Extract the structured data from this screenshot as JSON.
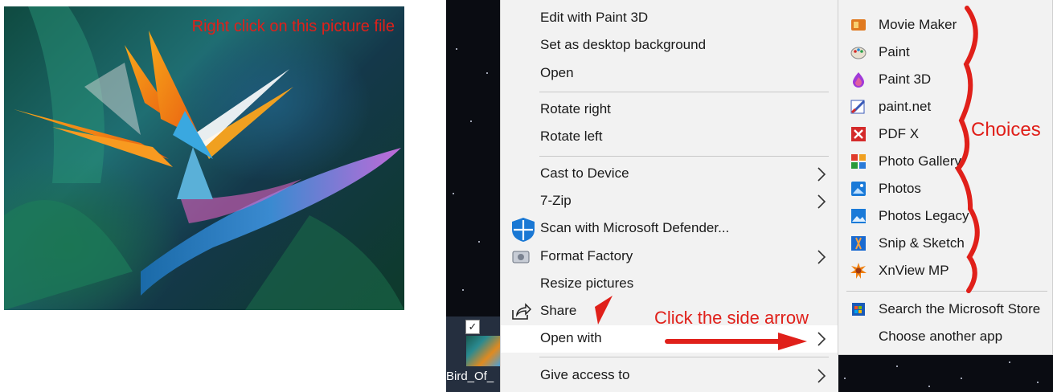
{
  "photo": {
    "caption": "Right click on this picture file",
    "caption_color": "#e0201a"
  },
  "desktop": {
    "file_label": "Bird_Of_",
    "checkbox": "✓"
  },
  "context_menu": {
    "items": [
      {
        "label": "Edit with Paint 3D"
      },
      {
        "label": "Set as desktop background"
      },
      {
        "label": "Open"
      },
      {
        "label": "Rotate right"
      },
      {
        "label": "Rotate left"
      },
      {
        "label": "Cast to Device",
        "submenu": true
      },
      {
        "label": "7-Zip",
        "submenu": true
      },
      {
        "label": "Scan with Microsoft Defender...",
        "icon": "defender-shield-icon"
      },
      {
        "label": "Format Factory",
        "submenu": true,
        "icon": "format-factory-icon"
      },
      {
        "label": "Resize pictures"
      },
      {
        "label": "Share",
        "icon": "share-icon"
      },
      {
        "label": "Open with",
        "submenu": true,
        "highlighted": true
      },
      {
        "label": "Give access to",
        "submenu": true
      }
    ]
  },
  "open_with_submenu": {
    "apps": [
      {
        "label": "Movie Maker",
        "icon": "movie-maker-icon",
        "color": "#e07a20"
      },
      {
        "label": "Paint",
        "icon": "paint-palette-icon",
        "color": "#3a7ad8"
      },
      {
        "label": "Paint 3D",
        "icon": "paint-3d-icon",
        "color": "#9a3ad8"
      },
      {
        "label": "paint.net",
        "icon": "paint-net-icon",
        "color": "#3a5ab8"
      },
      {
        "label": "PDF X",
        "icon": "pdf-x-icon",
        "color": "#d42a2a"
      },
      {
        "label": "Photo Gallery",
        "icon": "photo-gallery-icon",
        "color": "#e0a020"
      },
      {
        "label": "Photos",
        "icon": "photos-icon",
        "color": "#1a7ad8"
      },
      {
        "label": "Photos Legacy",
        "icon": "photos-legacy-icon",
        "color": "#1a7ad8"
      },
      {
        "label": "Snip & Sketch",
        "icon": "snip-sketch-icon",
        "color": "#1a6ad0"
      },
      {
        "label": "XnView MP",
        "icon": "xnview-icon",
        "color": "#e07010"
      }
    ],
    "store": {
      "label": "Search the Microsoft Store",
      "icon": "store-icon"
    },
    "choose": {
      "label": "Choose another app"
    }
  },
  "annotations": {
    "choices": "Choices",
    "click_arrow": "Click the side arrow",
    "color": "#e0201a"
  }
}
